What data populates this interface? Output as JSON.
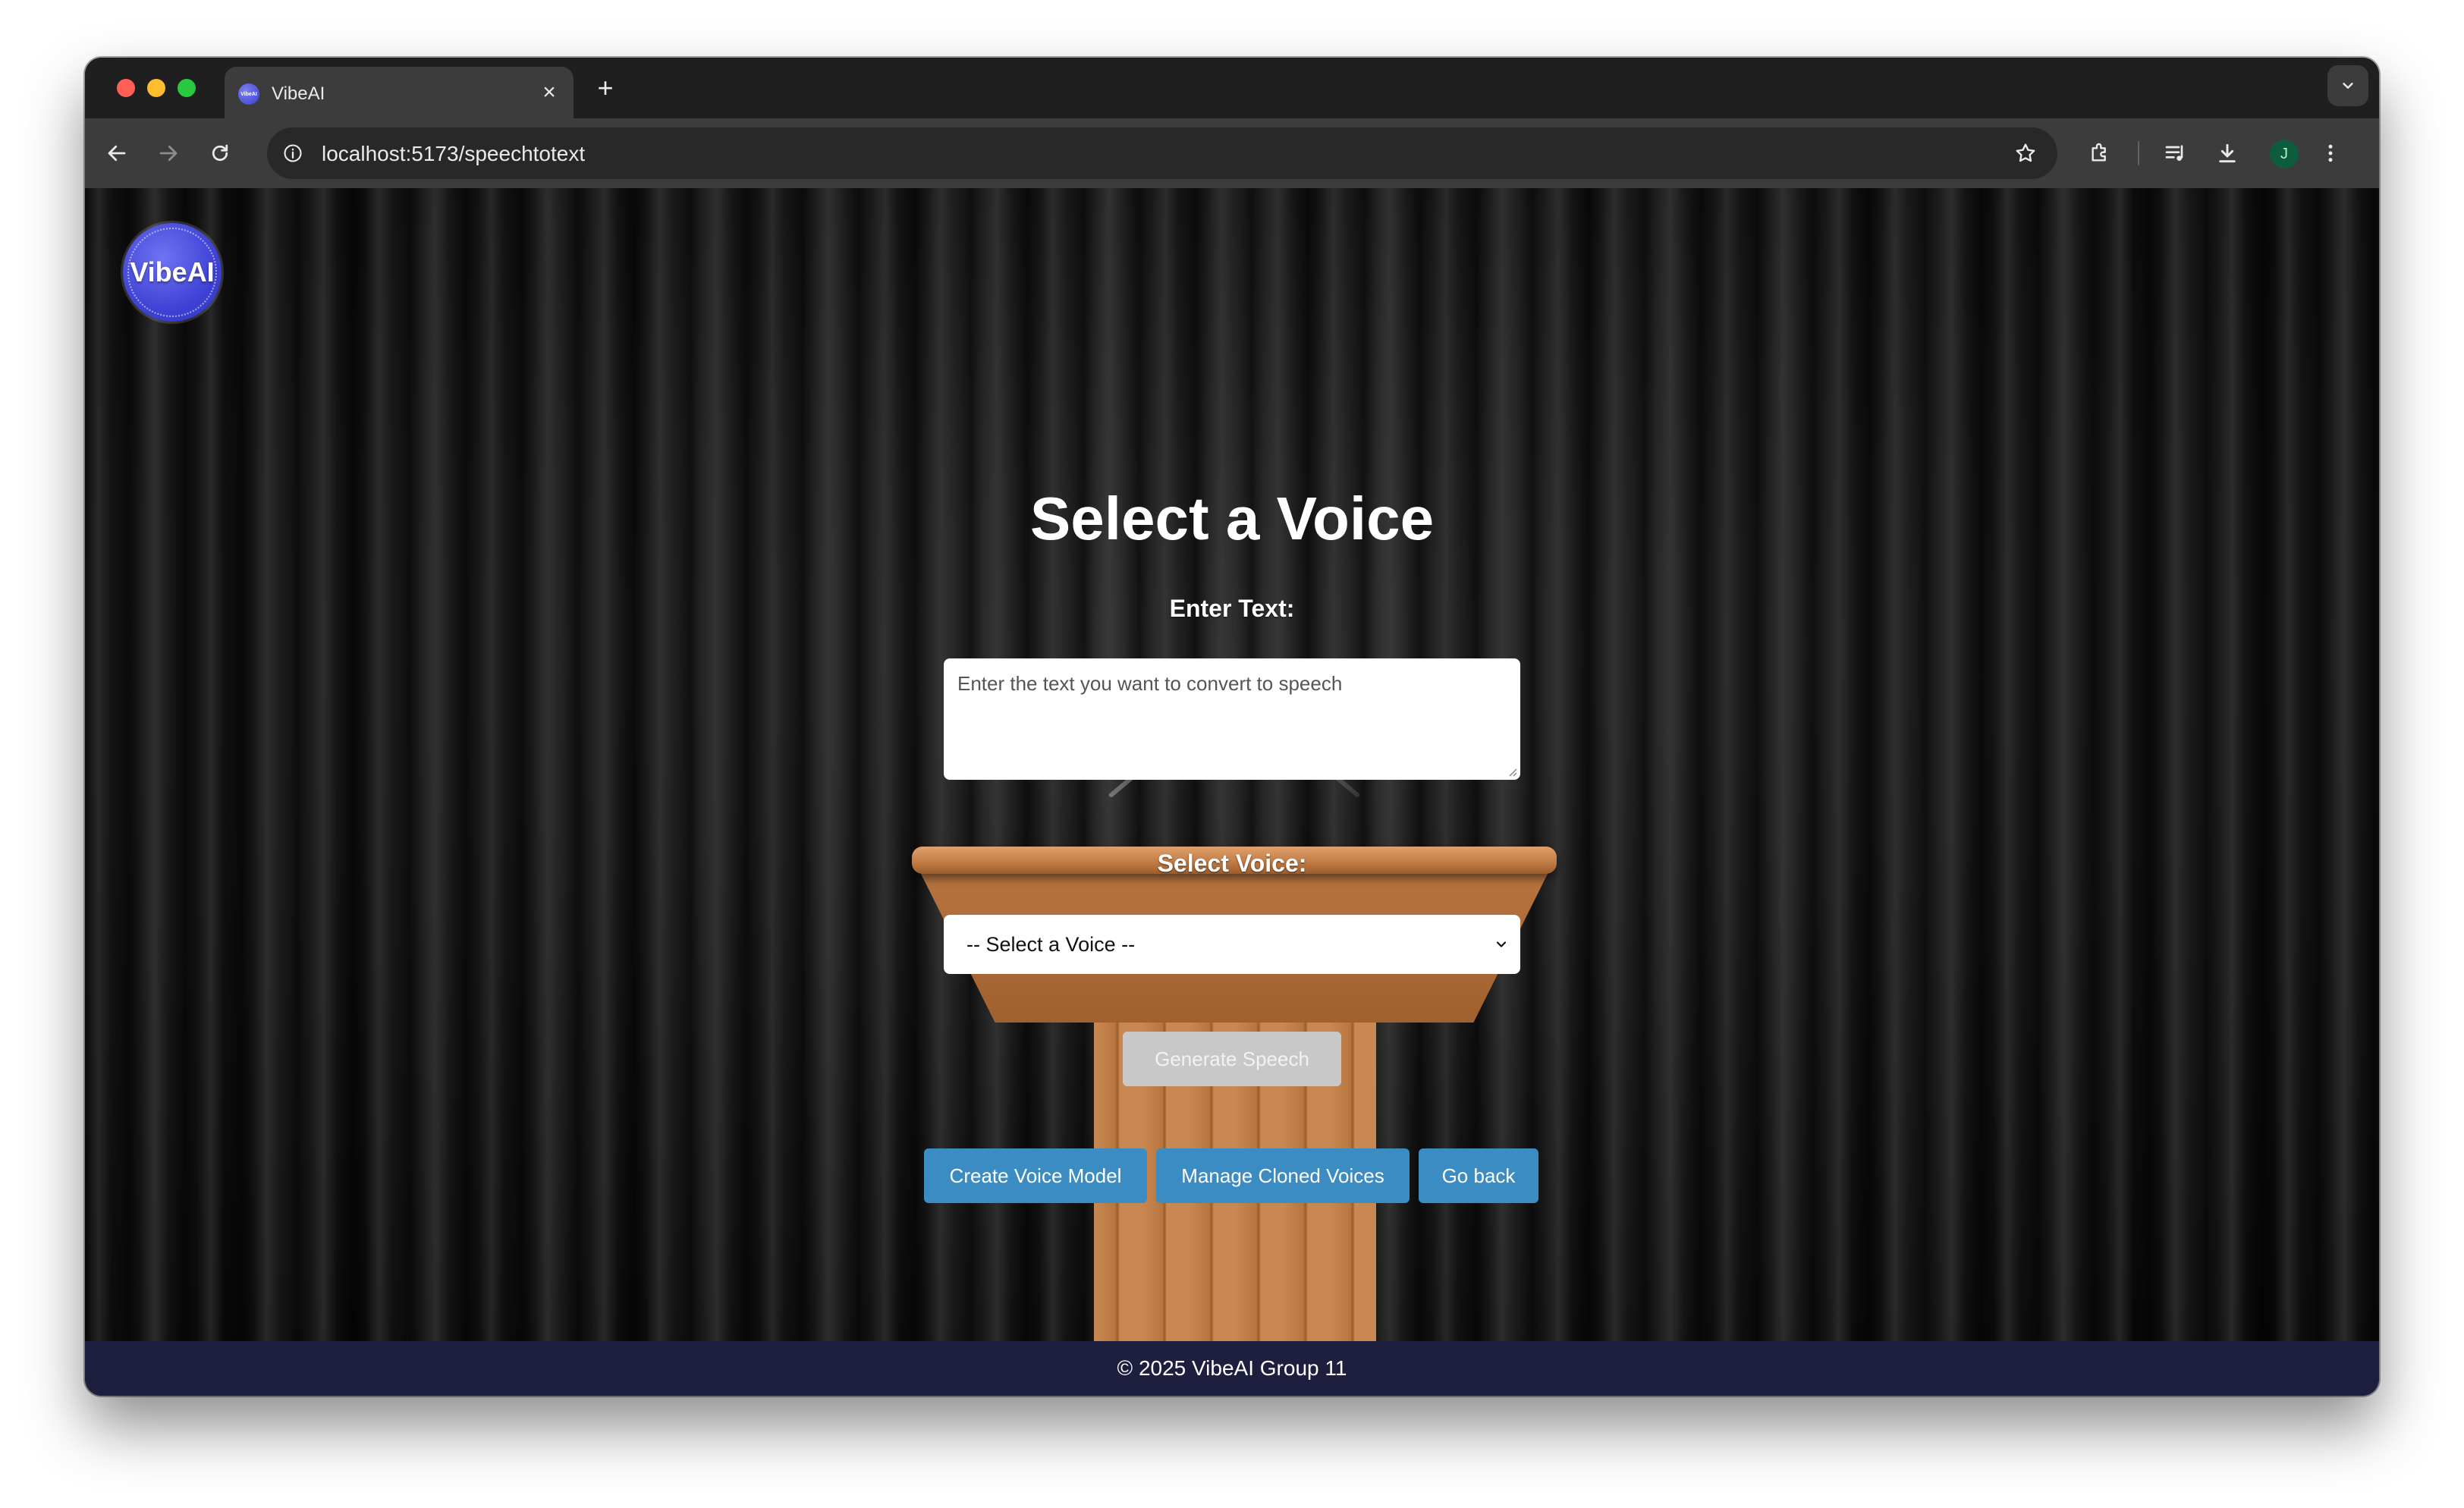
{
  "browser": {
    "tab_title": "VibeAI",
    "tab_favicon_text": "VibeAI",
    "close_glyph": "×",
    "new_tab_glyph": "+",
    "url": "localhost:5173/speechtotext",
    "profile_initial": "J"
  },
  "page": {
    "logo_text": "VibeAI",
    "title": "Select a Voice",
    "text_label": "Enter Text:",
    "textarea_placeholder": "-- placeholder --",
    "textarea_value": "",
    "voice_label": "Select Voice:",
    "voice_select_value": "-- Select a Voice --",
    "generate_button": "Generate Speech",
    "create_button": "Create Voice Model",
    "manage_button": "Manage Cloned Voices",
    "back_button": "Go back",
    "footer": "© 2025 VibeAI Group 11"
  },
  "placeholders": {
    "textarea": "Enter the text you want to convert to speech"
  },
  "colors": {
    "accent_button": "#3a8cc3",
    "disabled_button": "#c8c8c8",
    "footer_bg": "#1e1f3f",
    "logo": "#4448d8"
  }
}
